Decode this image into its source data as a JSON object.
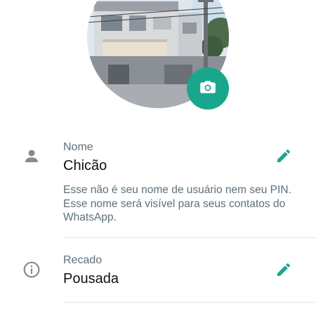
{
  "profile": {
    "photo_alt": "profile-photo-house",
    "camera_icon": "camera-icon",
    "accent_color": "#1aa68c"
  },
  "name_section": {
    "icon": "person-icon",
    "label": "Nome",
    "value": "Chicão",
    "helper": "Esse não é seu nome de usuário nem seu PIN. Esse nome será visível para seus contatos do WhatsApp.",
    "edit_icon": "pencil-icon"
  },
  "about_section": {
    "icon": "info-icon",
    "label": "Recado",
    "value": "Pousada",
    "edit_icon": "pencil-icon"
  }
}
